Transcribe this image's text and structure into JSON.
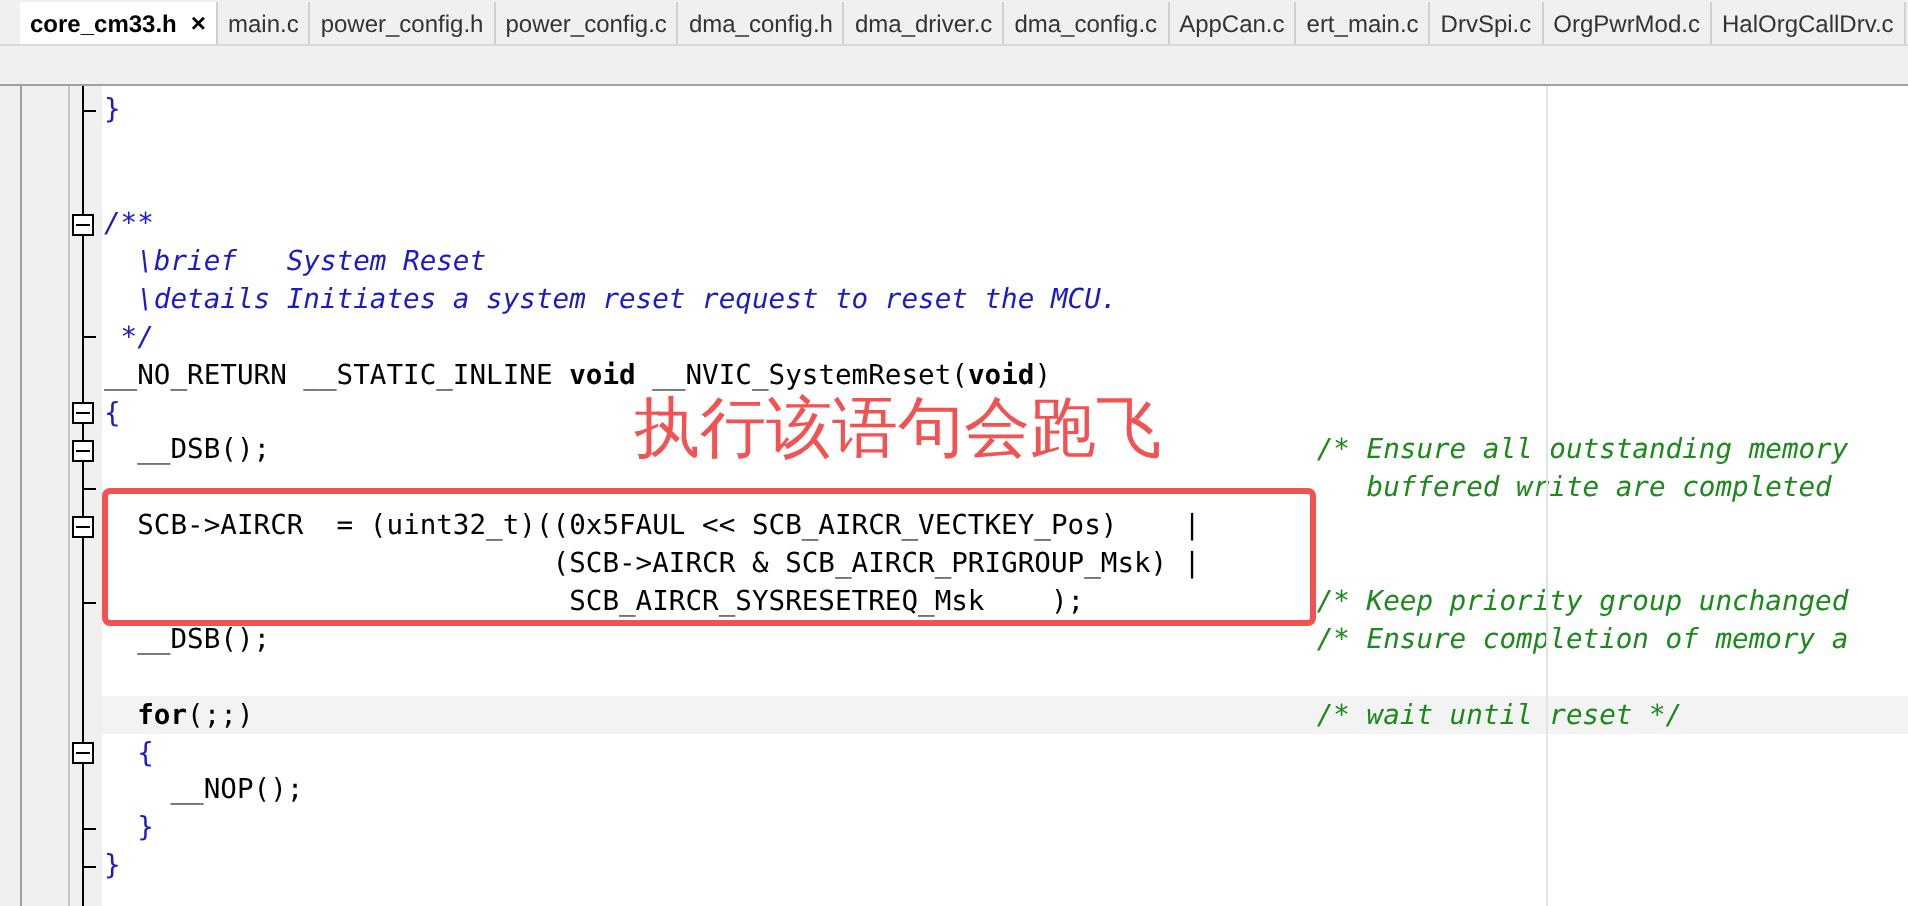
{
  "tabs": [
    {
      "label": "core_cm33.h",
      "selected": true,
      "close": "×"
    },
    {
      "label": "main.c",
      "selected": false
    },
    {
      "label": "power_config.h",
      "selected": false
    },
    {
      "label": "power_config.c",
      "selected": false
    },
    {
      "label": "dma_config.h",
      "selected": false
    },
    {
      "label": "dma_driver.c",
      "selected": false
    },
    {
      "label": "dma_config.c",
      "selected": false
    },
    {
      "label": "AppCan.c",
      "selected": false
    },
    {
      "label": "ert_main.c",
      "selected": false
    },
    {
      "label": "DrvSpi.c",
      "selected": false
    },
    {
      "label": "OrgPwrMod.c",
      "selected": false
    },
    {
      "label": "HalOrgCallDrv.c",
      "selected": false
    }
  ],
  "editor": {
    "lines": [
      {
        "kind": "brace",
        "code": "}",
        "collapsible": false,
        "block_end": true,
        "current": false
      },
      {
        "kind": "blank",
        "collapsible": false,
        "block_end": false,
        "current": false
      },
      {
        "kind": "blank",
        "collapsible": false,
        "block_end": false,
        "current": false
      },
      {
        "kind": "doc",
        "code": "/**",
        "collapsible": true,
        "block_end": false,
        "current": false
      },
      {
        "kind": "doc",
        "code": "  \\brief   System Reset",
        "collapsible": false,
        "block_end": false,
        "current": false
      },
      {
        "kind": "doc",
        "code": "  \\details Initiates a system reset request to reset the MCU.",
        "collapsible": false,
        "block_end": false,
        "current": false
      },
      {
        "kind": "doc",
        "code": " */",
        "collapsible": false,
        "block_end": true,
        "current": false
      },
      {
        "kind": "code",
        "code": "__NO_RETURN __STATIC_INLINE **void** __NVIC_SystemReset(**void**)",
        "collapsible": false,
        "block_end": false,
        "current": false
      },
      {
        "kind": "brace",
        "code": "{",
        "collapsible": true,
        "block_end": false,
        "current": false
      },
      {
        "kind": "code",
        "code": "  __DSB();",
        "comment": "/* Ensure all outstanding memory",
        "collapsible": true,
        "block_end": false,
        "current": false
      },
      {
        "kind": "blank",
        "comment": "   buffered write are completed",
        "collapsible": false,
        "block_end": true,
        "current": false
      },
      {
        "kind": "code",
        "code": "  SCB->AIRCR  = (uint32_t)((0x5FAUL << SCB_AIRCR_VECTKEY_Pos)    |",
        "collapsible": true,
        "block_end": false,
        "current": false
      },
      {
        "kind": "code",
        "code": "                           (SCB->AIRCR & SCB_AIRCR_PRIGROUP_Msk) |",
        "collapsible": false,
        "block_end": false,
        "current": false
      },
      {
        "kind": "code",
        "code": "                            SCB_AIRCR_SYSRESETREQ_Msk    );",
        "comment": "/* Keep priority group unchanged",
        "collapsible": false,
        "block_end": true,
        "current": false
      },
      {
        "kind": "code",
        "code": "  __DSB();",
        "comment": "/* Ensure completion of memory a",
        "collapsible": false,
        "block_end": false,
        "current": false
      },
      {
        "kind": "blank",
        "collapsible": false,
        "block_end": false,
        "current": false
      },
      {
        "kind": "code",
        "code": "  **for**(;;)",
        "comment": "/* wait until reset */",
        "collapsible": false,
        "block_end": false,
        "current": true
      },
      {
        "kind": "brace",
        "code": "  {",
        "collapsible": true,
        "block_end": false,
        "current": false
      },
      {
        "kind": "code",
        "code": "    __NOP();",
        "collapsible": false,
        "block_end": false,
        "current": false
      },
      {
        "kind": "brace",
        "code": "  }",
        "collapsible": false,
        "block_end": true,
        "current": false
      },
      {
        "kind": "brace",
        "code": "}",
        "collapsible": false,
        "block_end": true,
        "current": false
      }
    ]
  },
  "annotation": {
    "text": "执行该语句会跑飞"
  }
}
